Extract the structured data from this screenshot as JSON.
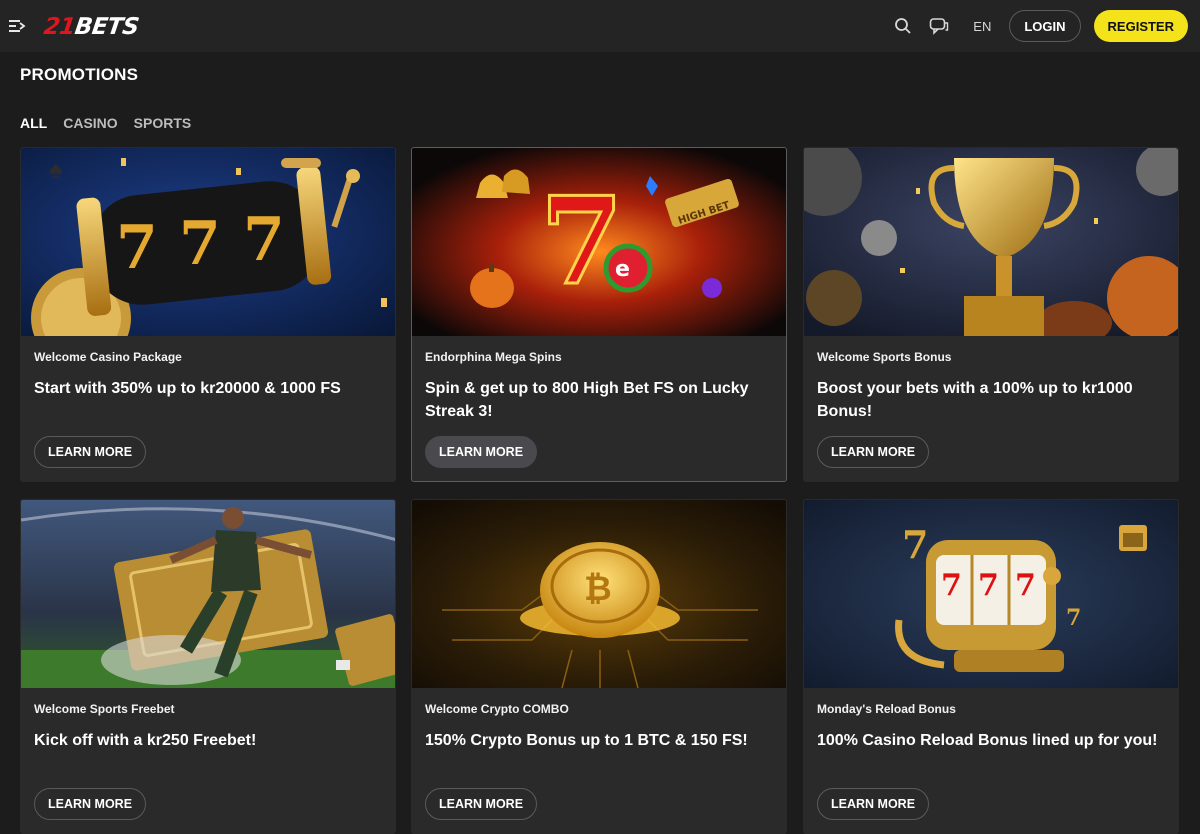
{
  "header": {
    "logo_number": "21",
    "logo_word": "BETS",
    "language": "EN",
    "login_label": "LOGIN",
    "register_label": "REGISTER"
  },
  "page": {
    "title": "PROMOTIONS",
    "filters": [
      {
        "label": "ALL",
        "active": true
      },
      {
        "label": "CASINO",
        "active": false
      },
      {
        "label": "SPORTS",
        "active": false
      }
    ]
  },
  "colors": {
    "background": "#1c1c1c",
    "header": "#242424",
    "card": "#2a2a2a",
    "register_button": "#f4e21b",
    "logo_red": "#e0161e"
  },
  "promotions": [
    {
      "subtitle": "Welcome Casino Package",
      "title": "Start with 350% up to kr20000 & 1000 FS",
      "button": "LEARN MORE",
      "image": "slot-reel-777"
    },
    {
      "subtitle": "Endorphina Mega Spins",
      "title": "Spin & get up to 800 High Bet FS on Lucky Streak 3!",
      "button": "LEARN MORE",
      "image": "lucky-seven-fire"
    },
    {
      "subtitle": "Welcome Sports Bonus",
      "title": "Boost your bets with a 100% up to kr1000 Bonus!",
      "button": "LEARN MORE",
      "image": "golden-trophy"
    },
    {
      "subtitle": "Welcome Sports Freebet",
      "title": "Kick off with a kr250 Freebet!",
      "button": "LEARN MORE",
      "image": "football-player"
    },
    {
      "subtitle": "Welcome Crypto COMBO",
      "title": "150% Crypto Bonus up to 1 BTC & 150 FS!",
      "button": "LEARN MORE",
      "image": "bitcoin-coin"
    },
    {
      "subtitle": "Monday's Reload Bonus",
      "title": "100% Casino Reload Bonus lined up for you!",
      "button": "LEARN MORE",
      "image": "slot-machine-777"
    }
  ]
}
